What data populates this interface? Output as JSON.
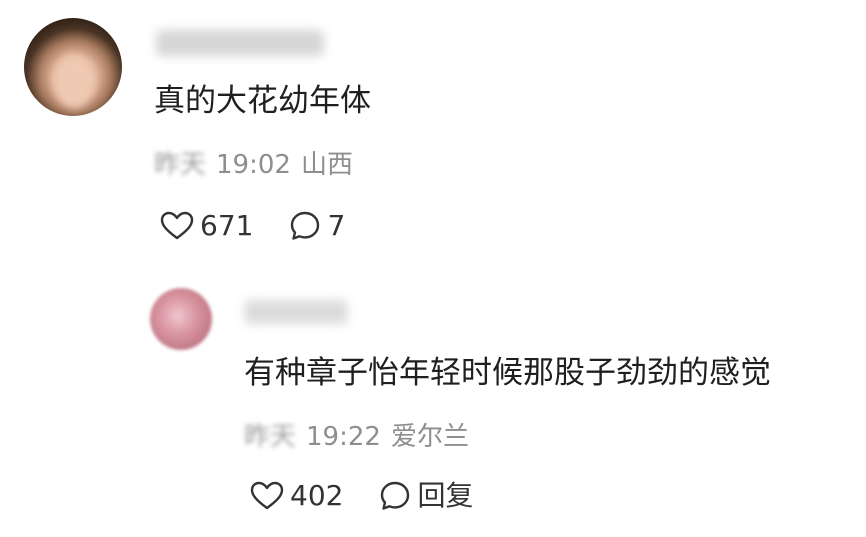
{
  "comment": {
    "text": "真的大花幼年体",
    "date": "昨天",
    "time": "19:02",
    "location": "山西",
    "likes": "671",
    "replies": "7"
  },
  "reply": {
    "text": "有种章子怡年轻时候那股子劲劲的感觉",
    "date": "昨天",
    "time": "19:22",
    "location": "爱尔兰",
    "likes": "402",
    "reply_label": "回复"
  },
  "icons": {
    "like": "heart-outline-icon",
    "comment": "speech-bubble-icon"
  },
  "colors": {
    "text": "#1f1f1f",
    "meta": "#8e8e8e",
    "icon": "#333333"
  }
}
